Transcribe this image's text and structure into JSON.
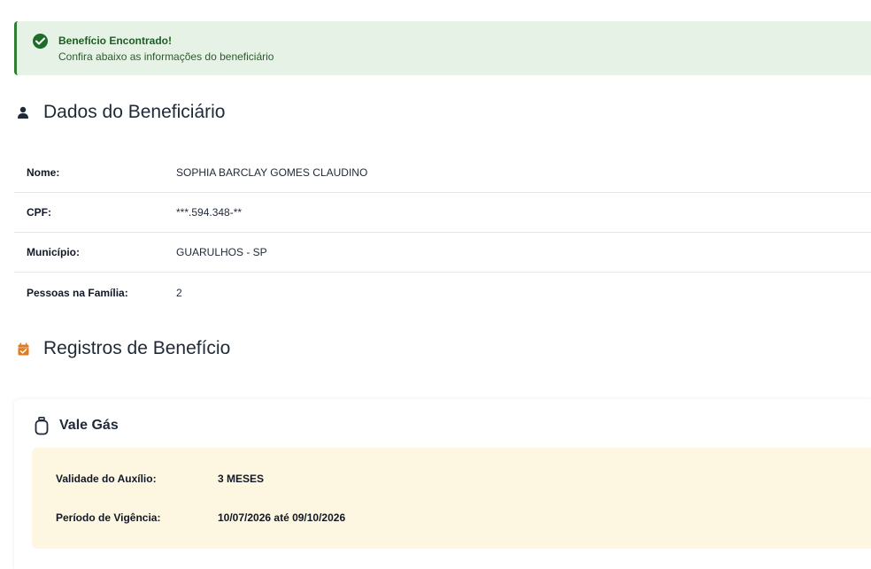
{
  "alert": {
    "title": "Benefício Encontrado!",
    "description": "Confira abaixo as informações do beneficiário",
    "icon": "check-circle-icon",
    "color": "#2e7d32"
  },
  "beneficiary_section": {
    "title": "Dados do Beneficiário",
    "icon": "user-icon",
    "rows": [
      {
        "label": "Nome:",
        "value": "SOPHIA BARCLAY GOMES CLAUDINO"
      },
      {
        "label": "CPF:",
        "value": "***.594.348-**"
      },
      {
        "label": "Município:",
        "value": "GUARULHOS - SP"
      },
      {
        "label": "Pessoas na Família:",
        "value": "2"
      }
    ]
  },
  "records_section": {
    "title": "Registros de Benefício",
    "icon": "calendar-check-icon",
    "icon_color": "#e07b20"
  },
  "benefit_card": {
    "title": "Vale Gás",
    "icon": "gas-cylinder-icon",
    "background": "#fdf6e0",
    "rows": [
      {
        "label": "Validade do Auxílio:",
        "value": "3 MESES"
      },
      {
        "label": "Período de Vigência:",
        "value": "10/07/2026 até 09/10/2026"
      }
    ]
  }
}
